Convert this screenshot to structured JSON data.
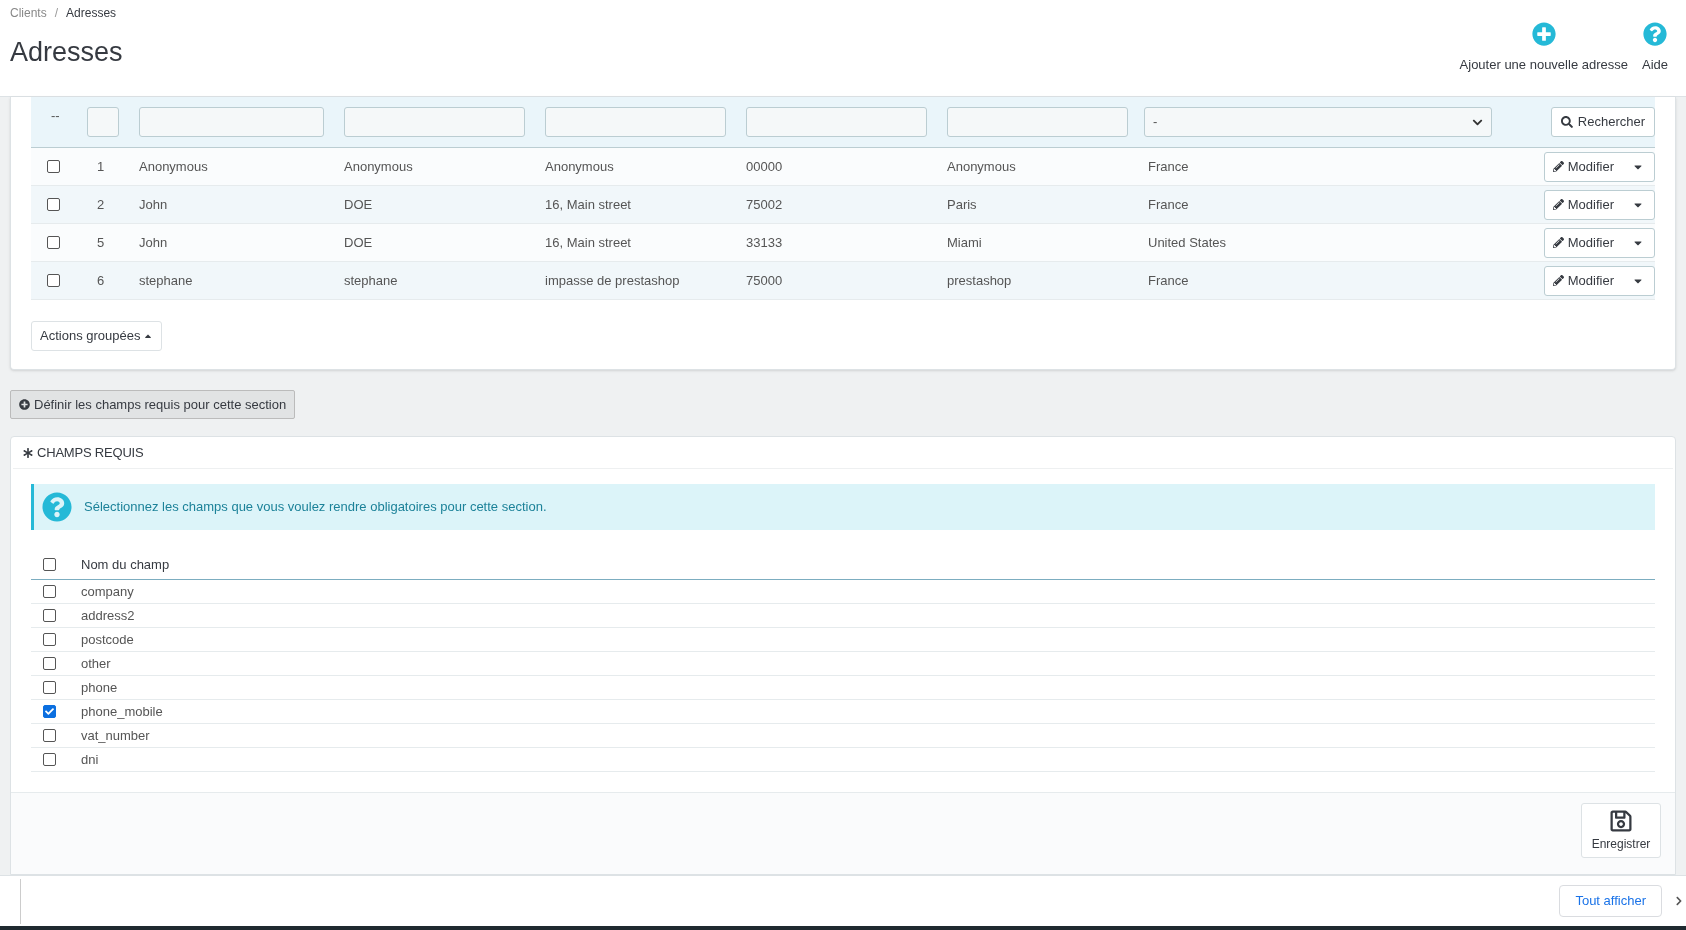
{
  "breadcrumb": [
    "Clients",
    "Adresses"
  ],
  "breadcrumb_separator": "/",
  "title": "Adresses",
  "toolbar": [
    {
      "kind": "add",
      "label": "Ajouter une nouvelle adresse"
    },
    {
      "kind": "help",
      "label": "Aide"
    }
  ],
  "table": {
    "filter_label": "--",
    "filters": [
      {
        "kind": "text"
      },
      {
        "kind": "text"
      },
      {
        "kind": "text"
      },
      {
        "kind": "text"
      },
      {
        "kind": "text"
      },
      {
        "kind": "text"
      },
      {
        "kind": "select",
        "value": "-"
      }
    ],
    "search_button": "Rechercher",
    "rows": [
      {
        "checked": false,
        "cells": [
          "1",
          "Anonymous",
          "Anonymous",
          "Anonymous",
          "00000",
          "Anonymous",
          "France"
        ],
        "action": "Modifier"
      },
      {
        "checked": false,
        "cells": [
          "2",
          "John",
          "DOE",
          "16, Main street",
          "75002",
          "Paris",
          "France"
        ],
        "action": "Modifier"
      },
      {
        "checked": false,
        "cells": [
          "5",
          "John",
          "DOE",
          "16, Main street",
          "33133",
          "Miami",
          "United States"
        ],
        "action": "Modifier"
      },
      {
        "checked": false,
        "cells": [
          "6",
          "stephane",
          "stephane",
          "impasse de prestashop",
          "75000",
          "prestashop",
          "France"
        ],
        "action": "Modifier"
      }
    ],
    "bulk_button": "Actions groupées"
  },
  "define_button": "Définir les champs requis pour cette section",
  "required_panel": {
    "title": "CHAMPS REQUIS",
    "info": "Sélectionnez les champs que vous voulez rendre obligatoires pour cette section.",
    "header": {
      "checked": false,
      "label": "Nom du champ"
    },
    "fields": [
      {
        "name": "company",
        "checked": false
      },
      {
        "name": "address2",
        "checked": false
      },
      {
        "name": "postcode",
        "checked": false
      },
      {
        "name": "other",
        "checked": false
      },
      {
        "name": "phone",
        "checked": false
      },
      {
        "name": "phone_mobile",
        "checked": true
      },
      {
        "name": "vat_number",
        "checked": false
      },
      {
        "name": "dni",
        "checked": false
      }
    ],
    "save_button": "Enregistrer"
  },
  "download_bar": {
    "button": "Tout afficher"
  }
}
